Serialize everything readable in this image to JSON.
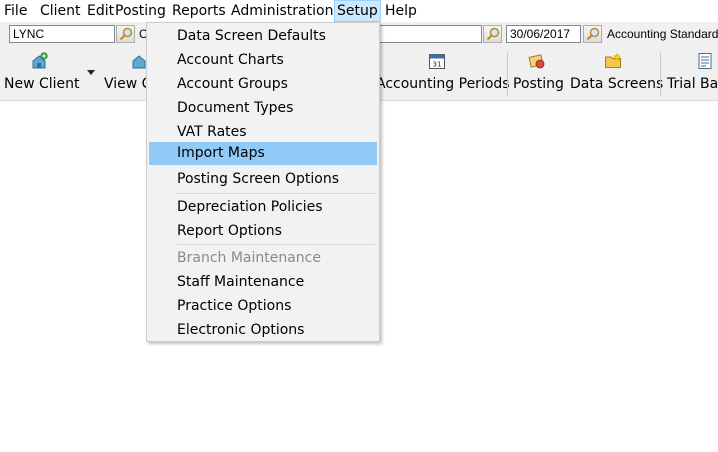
{
  "menubar": {
    "items": [
      "File",
      "Client",
      "Edit",
      "Posting",
      "Reports",
      "Administration",
      "Setup",
      "Help"
    ],
    "active": "Setup"
  },
  "filterbar": {
    "client_code": "LYNC",
    "client_name_partial": "C",
    "date": "30/06/2017",
    "standard": "Accounting Standard"
  },
  "toolbar": {
    "new_client": "New Client",
    "view_client": "View C",
    "accounting_periods": "Accounting Periods",
    "posting": "Posting",
    "data_screens": "Data Screens",
    "trial_balance": "Trial Bal",
    "calendar_day": "31"
  },
  "setup_menu": {
    "items": [
      "Data Screen Defaults",
      "Account Charts",
      "Account Groups",
      "Document Types",
      "VAT Rates",
      "Import Maps",
      "Posting Screen Options",
      "Depreciation Policies",
      "Report Options",
      "Branch Maintenance",
      "Staff Maintenance",
      "Practice Options",
      "Electronic Options"
    ],
    "highlighted": "Import Maps",
    "disabled": [
      "Branch Maintenance"
    ]
  },
  "colors": {
    "menu_highlight": "#91c9f7",
    "active_menu_bg": "#cce8ff",
    "toolbar_bg": "#f0f0f0"
  }
}
